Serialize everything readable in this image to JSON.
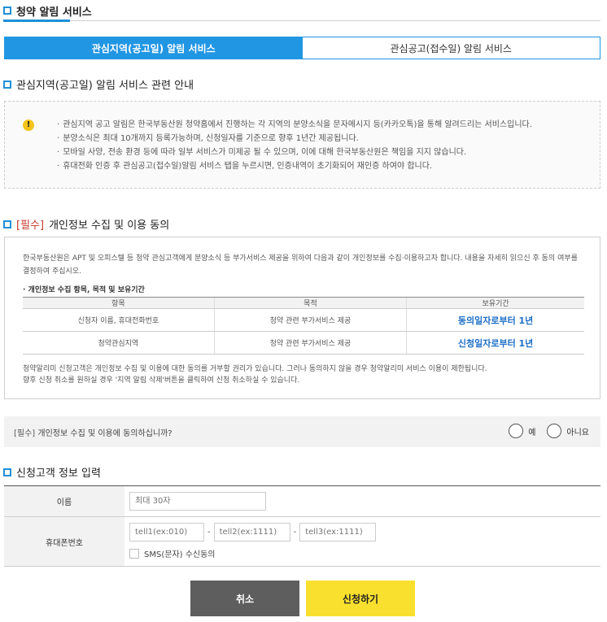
{
  "header": {
    "title": "청약 알림 서비스"
  },
  "tabs": [
    {
      "label": "관심지역(공고일) 알림 서비스",
      "active": true
    },
    {
      "label": "관심공고(접수일) 알림 서비스",
      "active": false
    }
  ],
  "guide": {
    "title": "관심지역(공고일) 알림 서비스 관련 안내",
    "items": [
      "관심지역 공고 알림은 한국부동산원 청약홈에서 진행하는 각 지역의 분양소식을 문자메시지 등(카카오톡)을 통해 알려드리는 서비스입니다.",
      "분양소식은 최대 10개까지 등록가능하며, 신청일자를 기준으로 향후 1년간 제공됩니다.",
      "모바일 사양, 전송 환경 등에 따라 일부 서비스가 미제공 될 수 있으며, 이에 대해 한국부동산원은 책임을 지지 않습니다.",
      "휴대전화 인증 후 관심공고(접수일)알림 서비스 탭을 누르시면, 인증내역이 초기화되어 재인증 하여야 합니다."
    ]
  },
  "privacy": {
    "req": "[필수]",
    "title": "개인정보 수집 및 이용 동의",
    "intro": "한국부동산원은 APT 및 오피스텔 등 청약 관심고객에게 분양소식 등 부가서비스 제공을 위하여 다음과 같이 개인정보를 수집·이용하고자 합니다. 내용을 자세히 읽으신 후 동의 여부를 결정하여 주십시오.",
    "subtitle": "· 개인정보 수집 항목, 목적 및 보유기간",
    "columns": [
      "항목",
      "목적",
      "보유기간"
    ],
    "rows": [
      [
        "신청자 이름, 휴대전화번호",
        "청약 관련 부가서비스 제공",
        "동의일자로부터 1년"
      ],
      [
        "청약관심지역",
        "청약 관련 부가서비스 제공",
        "신청일자로부터 1년"
      ]
    ],
    "note1": "청약알리미 신청고객은 개인정보 수집 및 이용에 대한 동의를 거부할 권리가 있습니다. 그러나 동의하지 않을 경우 청약알리미 서비스 이용이 제한됩니다.",
    "note2": "향후 신청 취소를 원하실 경우 '지역 알림 삭제'버튼을 클릭하여 신청 취소하실 수 있습니다."
  },
  "agree": {
    "req": "[필수]",
    "question": "개인정보 수집 및 이용에 동의하십니까?",
    "yes": "예",
    "no": "아니요"
  },
  "customer": {
    "title": "신청고객 정보 입력",
    "name_label": "이름",
    "name_placeholder": "최대 30자",
    "phone_label": "휴대폰번호",
    "tel1_placeholder": "tell1(ex:010)",
    "tel2_placeholder": "tell2(ex:1111)",
    "tel3_placeholder": "tell3(ex:1111)",
    "dash": "-",
    "sms_label": "SMS(문자) 수신동의"
  },
  "buttons": {
    "cancel": "취소",
    "apply": "신청하기"
  },
  "colors": {
    "accent": "#2196e3",
    "apply_button": "#f9e02e",
    "cancel_button": "#5e5e5e",
    "required": "#c8362a"
  }
}
